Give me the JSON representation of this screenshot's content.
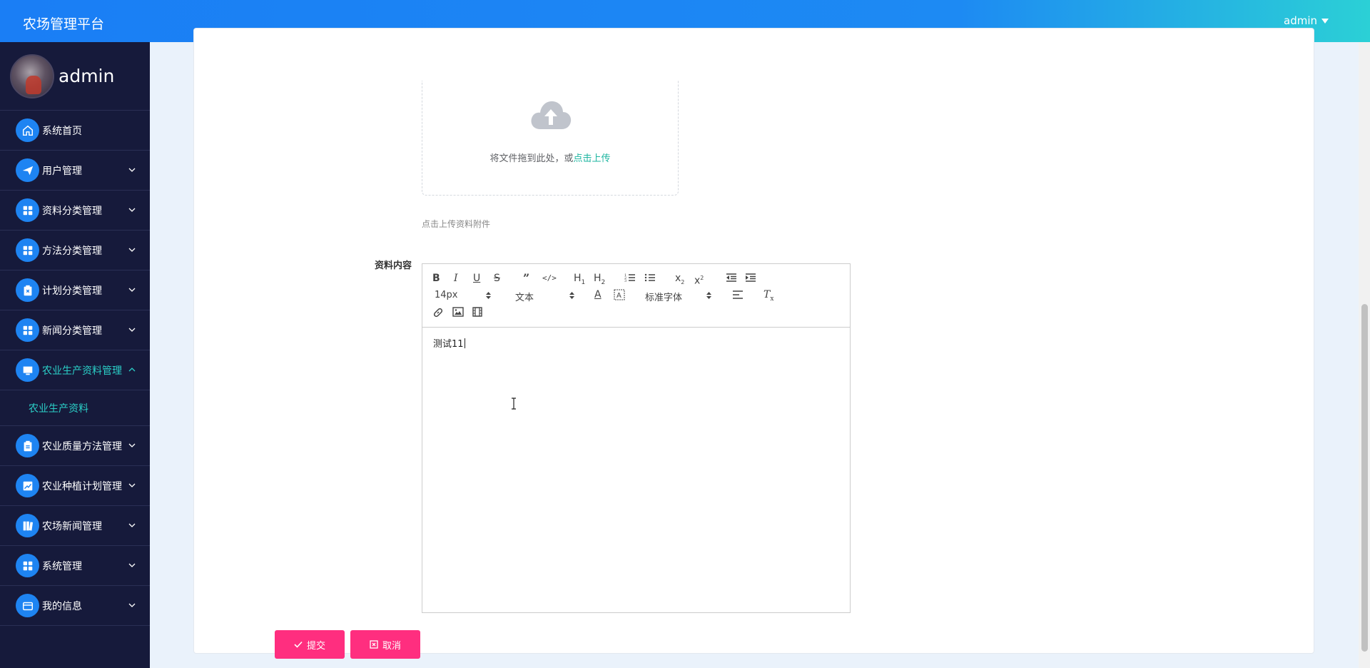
{
  "header": {
    "brand": "农场管理平台",
    "user": "admin"
  },
  "sidebar": {
    "profile_name": "admin",
    "items": [
      {
        "label": "系统首页",
        "icon": "home-icon"
      },
      {
        "label": "用户管理",
        "icon": "send-icon"
      },
      {
        "label": "资料分类管理",
        "icon": "grid-icon"
      },
      {
        "label": "方法分类管理",
        "icon": "grid-icon"
      },
      {
        "label": "计划分类管理",
        "icon": "clipboard-x-icon"
      },
      {
        "label": "新闻分类管理",
        "icon": "grid-icon"
      },
      {
        "label": "农业生产资料管理",
        "icon": "monitor-icon"
      },
      {
        "label": "农业质量方法管理",
        "icon": "clipboard-icon"
      },
      {
        "label": "农业种植计划管理",
        "icon": "chart-icon"
      },
      {
        "label": "农场新闻管理",
        "icon": "book-icon"
      },
      {
        "label": "系统管理",
        "icon": "grid-icon"
      },
      {
        "label": "我的信息",
        "icon": "card-icon"
      }
    ],
    "submenu_label": "农业生产资料"
  },
  "form": {
    "upload_text": "将文件拖到此处，或",
    "upload_link": "点击上传",
    "upload_tip": "点击上传资料附件",
    "content_label": "资料内容",
    "editor": {
      "font_size": "14px",
      "header_select": "文本",
      "font_family": "标准字体",
      "body_text": "测试11"
    },
    "submit_label": "提交",
    "cancel_label": "取消"
  },
  "colors": {
    "header_start": "#1a7ef5",
    "header_end": "#2bd0d6",
    "sidebar_bg": "#161a3b",
    "accent": "#1e84f2",
    "active_text": "#2bd0c8",
    "button": "#ff2e7f"
  }
}
